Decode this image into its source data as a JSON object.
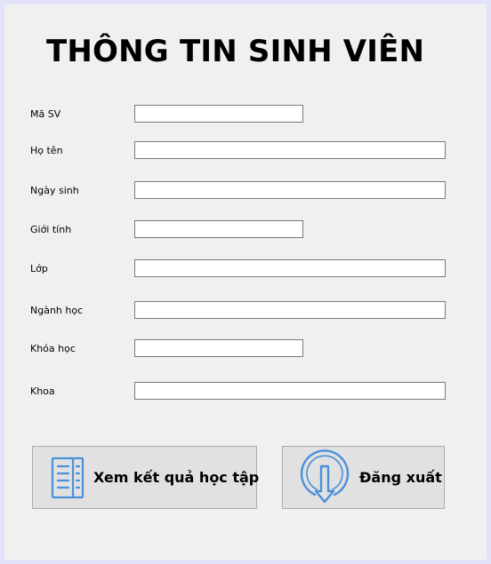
{
  "form": {
    "title": "THÔNG TIN SINH VIÊN",
    "fields": [
      {
        "label": "Mã SV",
        "value": ""
      },
      {
        "label": "Họ tên",
        "value": ""
      },
      {
        "label": "Ngày sinh",
        "value": ""
      },
      {
        "label": "Giới tính",
        "value": ""
      },
      {
        "label": "Lớp",
        "value": ""
      },
      {
        "label": "Ngành học",
        "value": ""
      },
      {
        "label": "Khóa học",
        "value": ""
      },
      {
        "label": "Khoa",
        "value": ""
      }
    ]
  },
  "buttons": {
    "results": {
      "label": "Xem kết quả học tập",
      "icon": "document-list-icon"
    },
    "logout": {
      "label": "Đăng xuất",
      "icon": "logout-circle-arrow-icon"
    }
  },
  "colors": {
    "background": "#f0f0f0",
    "window_border": "#e2e2f8",
    "button_face": "#e1e1e1",
    "icon_blue": "#4a90d9"
  }
}
